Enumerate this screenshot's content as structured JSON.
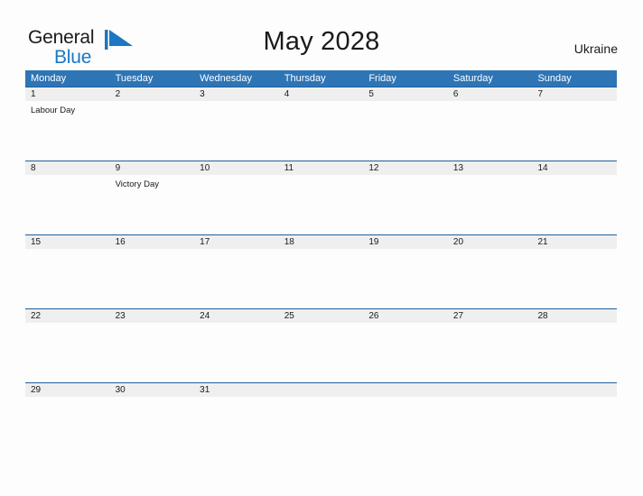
{
  "brand": {
    "name_part1": "General",
    "name_part2": "Blue",
    "flag_icon": "blue-flag-triangle",
    "color_dark": "#1a1a1a",
    "color_blue": "#1c76c4"
  },
  "header": {
    "title": "May 2028",
    "country": "Ukraine"
  },
  "theme": {
    "header_blue": "#2e75b6",
    "separator_blue": "#1f5fa0",
    "day_strip_gray": "#efefef",
    "page_background": "#fdfdfd",
    "text_color": "#1a1a1a",
    "header_text_color": "#ffffff"
  },
  "calendar": {
    "weekdays": [
      "Monday",
      "Tuesday",
      "Wednesday",
      "Thursday",
      "Friday",
      "Saturday",
      "Sunday"
    ],
    "weeks": [
      {
        "days": [
          {
            "number": "1",
            "event": "Labour Day"
          },
          {
            "number": "2",
            "event": ""
          },
          {
            "number": "3",
            "event": ""
          },
          {
            "number": "4",
            "event": ""
          },
          {
            "number": "5",
            "event": ""
          },
          {
            "number": "6",
            "event": ""
          },
          {
            "number": "7",
            "event": ""
          }
        ]
      },
      {
        "days": [
          {
            "number": "8",
            "event": ""
          },
          {
            "number": "9",
            "event": "Victory Day"
          },
          {
            "number": "10",
            "event": ""
          },
          {
            "number": "11",
            "event": ""
          },
          {
            "number": "12",
            "event": ""
          },
          {
            "number": "13",
            "event": ""
          },
          {
            "number": "14",
            "event": ""
          }
        ]
      },
      {
        "days": [
          {
            "number": "15",
            "event": ""
          },
          {
            "number": "16",
            "event": ""
          },
          {
            "number": "17",
            "event": ""
          },
          {
            "number": "18",
            "event": ""
          },
          {
            "number": "19",
            "event": ""
          },
          {
            "number": "20",
            "event": ""
          },
          {
            "number": "21",
            "event": ""
          }
        ]
      },
      {
        "days": [
          {
            "number": "22",
            "event": ""
          },
          {
            "number": "23",
            "event": ""
          },
          {
            "number": "24",
            "event": ""
          },
          {
            "number": "25",
            "event": ""
          },
          {
            "number": "26",
            "event": ""
          },
          {
            "number": "27",
            "event": ""
          },
          {
            "number": "28",
            "event": ""
          }
        ]
      },
      {
        "days": [
          {
            "number": "29",
            "event": ""
          },
          {
            "number": "30",
            "event": ""
          },
          {
            "number": "31",
            "event": ""
          },
          {
            "number": "",
            "event": ""
          },
          {
            "number": "",
            "event": ""
          },
          {
            "number": "",
            "event": ""
          },
          {
            "number": "",
            "event": ""
          }
        ]
      }
    ]
  }
}
